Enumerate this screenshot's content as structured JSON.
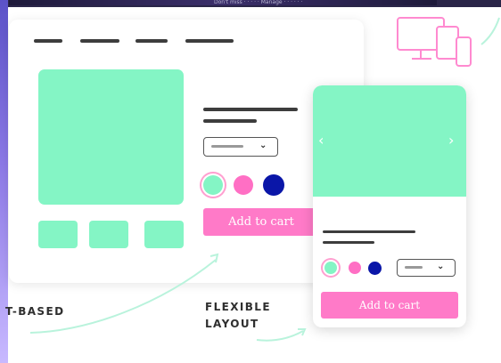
{
  "banner": {
    "faint_text": "Don't miss · · · · · Manage · · · · · ·"
  },
  "desktop": {
    "add_to_cart_label": "Add to cart",
    "swatches": [
      {
        "name": "mint",
        "color": "#84f5c5",
        "selected": true
      },
      {
        "name": "pink",
        "color": "#ff6fc4",
        "selected": false
      },
      {
        "name": "navy",
        "color": "#0a16a8",
        "selected": false
      }
    ]
  },
  "mobile": {
    "add_to_cart_label": "Add to cart",
    "prev_arrow": "‹",
    "next_arrow": "›",
    "swatches": [
      {
        "name": "mint",
        "color": "#84f5c5",
        "selected": true
      },
      {
        "name": "pink",
        "color": "#ff6fc4",
        "selected": false
      },
      {
        "name": "navy",
        "color": "#0a16a8",
        "selected": false
      }
    ]
  },
  "captions": {
    "left": "T-BASED",
    "right_line1": "FLEXIBLE",
    "right_line2": "LAYOUT"
  },
  "icons": {
    "devices": "devices-icon",
    "select_chevron": "chevron-down-icon"
  },
  "colors": {
    "mint": "#84f5c5",
    "pink_button": "#ff7ac8",
    "device_outline": "#ff8ad0",
    "swirl": "#b9f3dc"
  }
}
